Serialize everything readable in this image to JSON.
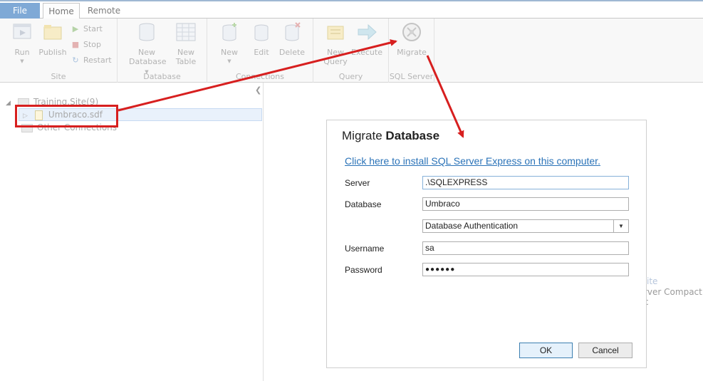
{
  "ribbon": {
    "tabs": [
      "File",
      "Home",
      "Remote"
    ],
    "groups": {
      "site": {
        "label": "Site",
        "run": "Run",
        "publish": "Publish",
        "start": "Start",
        "stop": "Stop",
        "restart": "Restart"
      },
      "database": {
        "label": "Database",
        "new_database": [
          "New",
          "Database"
        ],
        "new_table": [
          "New",
          "Table"
        ]
      },
      "connections": {
        "label": "Connections",
        "new": "New",
        "edit": "Edit",
        "delete": "Delete"
      },
      "query": {
        "label": "Query",
        "new_query": [
          "New",
          "Query"
        ],
        "execute": "Execute"
      },
      "sql_server": {
        "label": "SQL Server",
        "migrate": "Migrate"
      }
    }
  },
  "tree": {
    "site_node": "Training.Site(9)",
    "file_node": "Umbraco.sdf",
    "other_node": "Other Connections"
  },
  "background": {
    "hint_link": "ite",
    "hint_text": "rver Compact c"
  },
  "dialog": {
    "title_light": "Migrate ",
    "title_bold": "Database",
    "install_link": "Click here to install SQL Server Express on this computer.",
    "fields": {
      "server_label": "Server",
      "server_value": ".\\SQLEXPRESS",
      "database_label": "Database",
      "database_value": "Umbraco",
      "auth_value": "Database Authentication",
      "username_label": "Username",
      "username_value": "sa",
      "password_label": "Password",
      "password_value": "●●●●●●"
    },
    "ok": "OK",
    "cancel": "Cancel"
  },
  "colors": {
    "annotation": "#d71f1f",
    "link": "#2b73b8",
    "file_tab": "#7fa9d6"
  }
}
